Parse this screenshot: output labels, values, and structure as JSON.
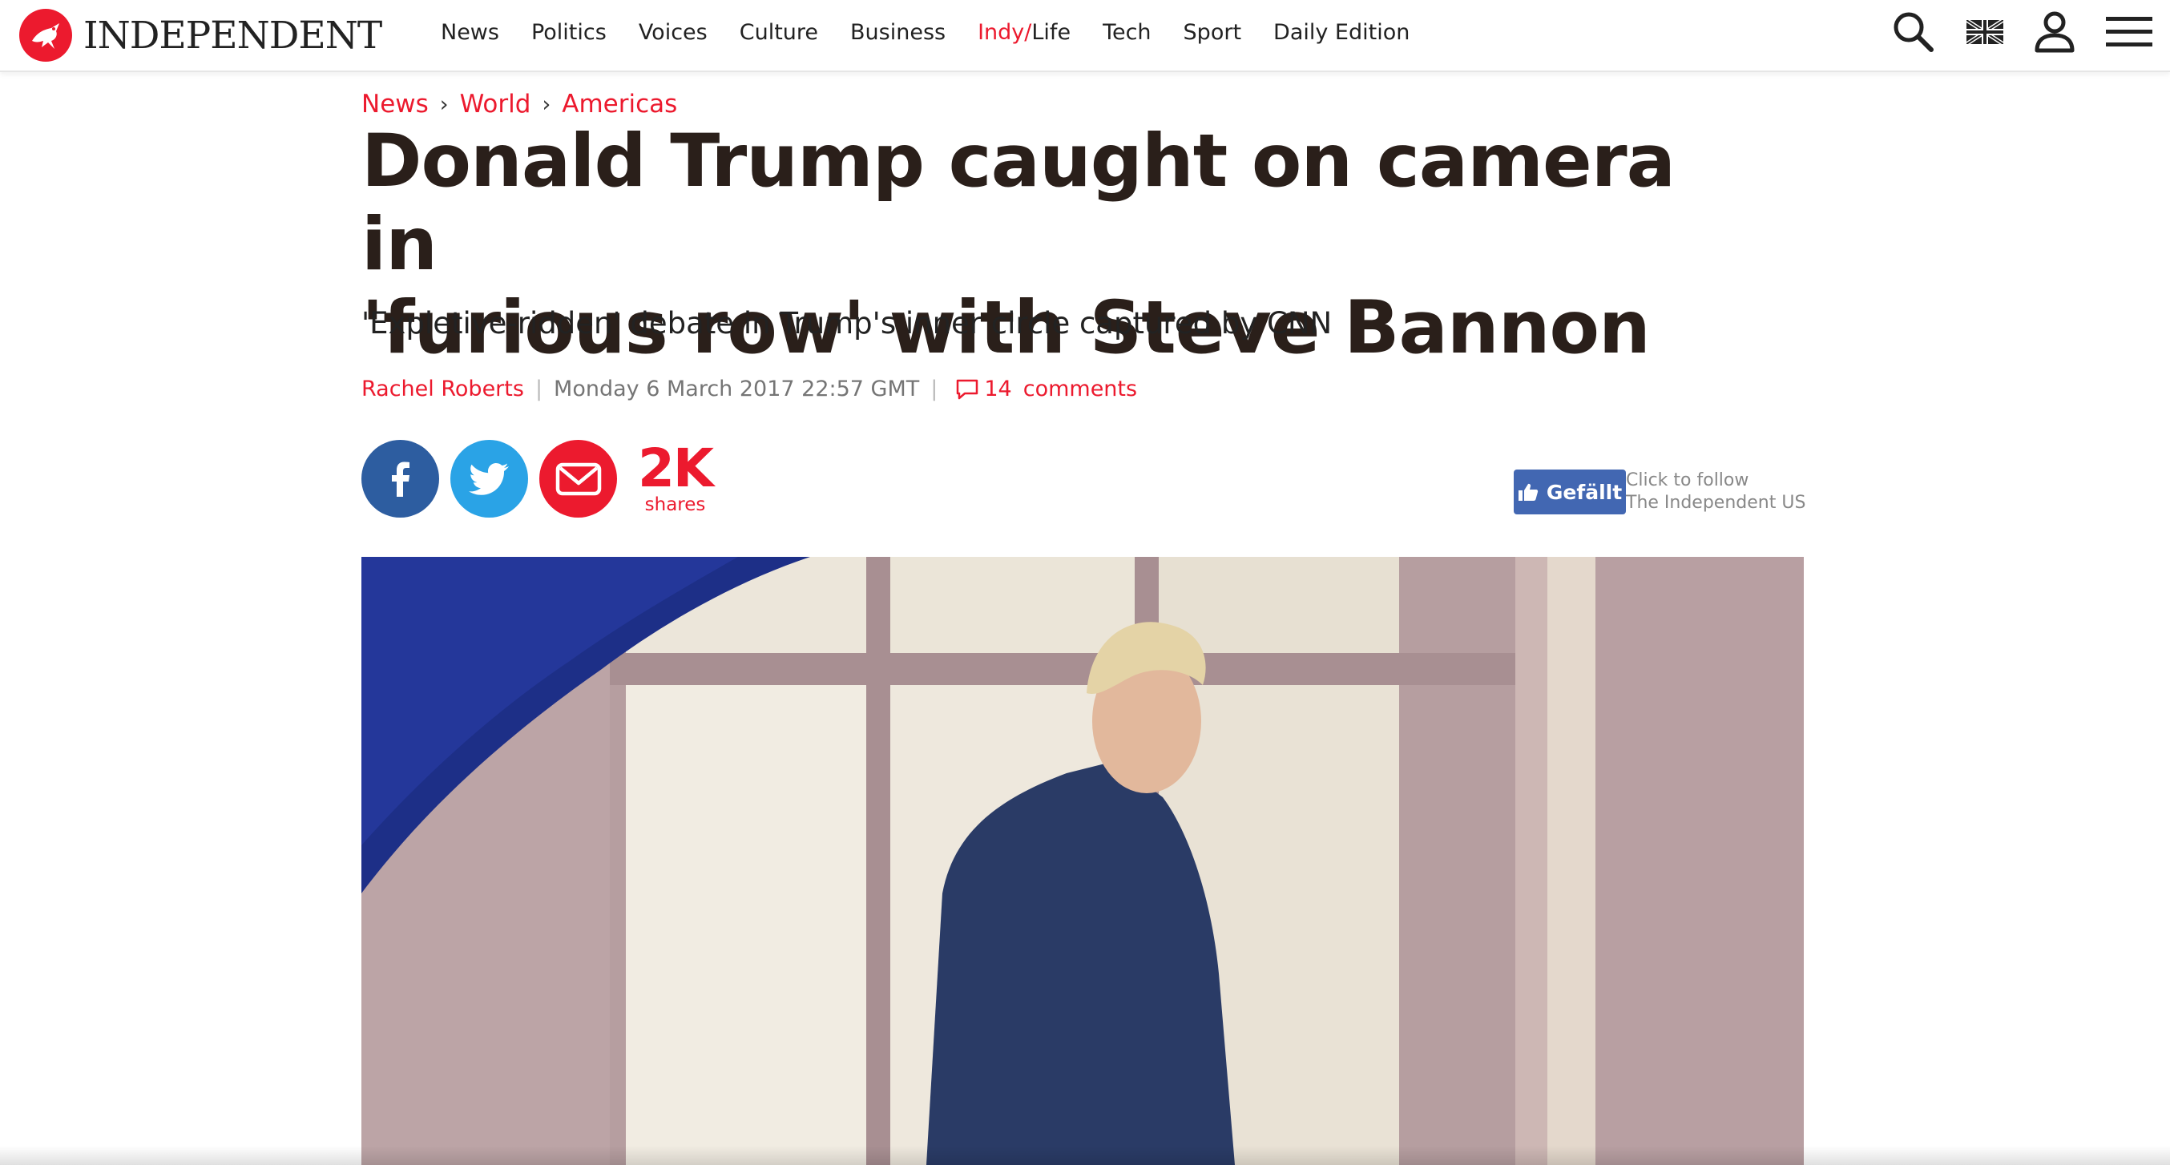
{
  "site": {
    "logo_text": "INDEPENDENT",
    "brand_color": "#ec1a2e"
  },
  "nav": {
    "items": [
      {
        "label": "News"
      },
      {
        "label": "Politics"
      },
      {
        "label": "Voices"
      },
      {
        "label": "Culture"
      },
      {
        "label": "Business"
      },
      {
        "label_red": "Indy/",
        "label": "Life"
      },
      {
        "label": "Tech"
      },
      {
        "label": "Sport"
      },
      {
        "label": "Daily Edition"
      }
    ]
  },
  "tools": {
    "icons": [
      "search-icon",
      "uk-flag-icon",
      "account-icon",
      "menu-icon"
    ]
  },
  "article": {
    "breadcrumb": [
      "News",
      "World",
      "Americas"
    ],
    "headline_line1": "Donald Trump caught on camera in",
    "headline_line2": "'furious row' with Steve Bannon",
    "standfirst": "'Expletive-ridden' debate in Trump's inner circle captured by CNN",
    "author": "Rachel Roberts",
    "date": "Monday 6 March 2017 22:57 GMT",
    "comments_count": "14",
    "comments_label": "comments"
  },
  "share": {
    "count": "2K",
    "label": "shares",
    "buttons": [
      "facebook-icon",
      "twitter-icon",
      "email-icon"
    ],
    "colors": {
      "facebook": "#2d5da0",
      "twitter": "#2aa3e6",
      "email": "#ec1a2e"
    }
  },
  "facebook_follow": {
    "button_label": "Gefällt",
    "line1": "Click to follow",
    "line2": "The Independent US",
    "color": "#4267b2"
  }
}
